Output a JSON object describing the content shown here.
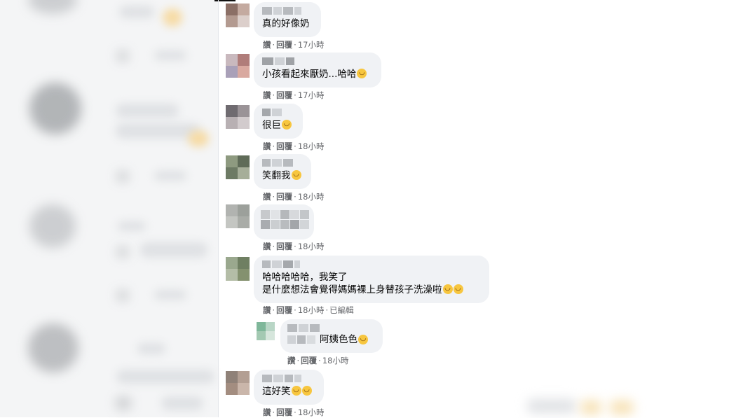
{
  "comments": [
    {
      "id": "c1",
      "text": "真的好像奶",
      "emojis": [],
      "like": "讚",
      "reply": "回覆",
      "time": "17小時",
      "extra": ""
    },
    {
      "id": "c2",
      "text": "小孩看起來厭奶...哈哈",
      "emojis": [
        "grin"
      ],
      "like": "讚",
      "reply": "回覆",
      "time": "17小時",
      "extra": ""
    },
    {
      "id": "c3",
      "text": "很巨",
      "emojis": [
        "grin"
      ],
      "like": "讚",
      "reply": "回覆",
      "time": "18小時",
      "extra": ""
    },
    {
      "id": "c4",
      "text": "笑翻我",
      "emojis": [
        "grin"
      ],
      "like": "讚",
      "reply": "回覆",
      "time": "18小時",
      "extra": ""
    },
    {
      "id": "c5",
      "text": "",
      "emojis": [],
      "like": "讚",
      "reply": "回覆",
      "time": "18小時",
      "extra": ""
    },
    {
      "id": "c6",
      "text": "哈哈哈哈哈，我笑了",
      "text2": "是什麼想法會覺得媽媽裸上身替孩子洗澡啦",
      "emojis": [
        "grin",
        "grin"
      ],
      "like": "讚",
      "reply": "回覆",
      "time": "18小時",
      "extra": "已編輯"
    },
    {
      "id": "c7",
      "text": "阿姨色色",
      "emojis": [
        "laugh"
      ],
      "like": "讚",
      "reply": "回覆",
      "time": "18小時",
      "extra": ""
    },
    {
      "id": "c8",
      "text": "這好笑",
      "emojis": [
        "rofl",
        "rofl"
      ],
      "like": "讚",
      "reply": "回覆",
      "time": "18小時",
      "extra": ""
    }
  ],
  "colors": {
    "bubble": "#f0f2f5",
    "meta": "#65676b",
    "text": "#050505"
  },
  "icons": {
    "grin": "grinning-face-icon",
    "laugh": "laughing-face-icon",
    "rofl": "rolling-laughing-face-icon"
  }
}
